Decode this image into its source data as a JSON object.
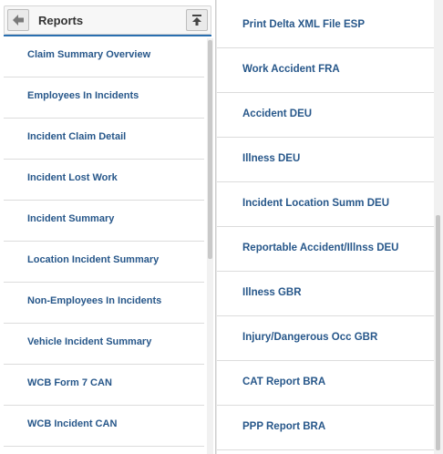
{
  "header": {
    "title": "Reports",
    "back_icon": "arrow-left-icon",
    "top_icon": "scroll-to-top-icon"
  },
  "left_list": [
    {
      "label": "Claim Summary Overview"
    },
    {
      "label": "Employees In Incidents"
    },
    {
      "label": "Incident Claim Detail"
    },
    {
      "label": "Incident Lost Work"
    },
    {
      "label": "Incident Summary"
    },
    {
      "label": "Location Incident Summary"
    },
    {
      "label": "Non-Employees In Incidents"
    },
    {
      "label": "Vehicle Incident Summary"
    },
    {
      "label": "WCB Form 7 CAN"
    },
    {
      "label": "WCB Incident CAN"
    }
  ],
  "right_list": [
    {
      "label": "Print Delta XML File ESP"
    },
    {
      "label": "Work Accident FRA"
    },
    {
      "label": "Accident DEU"
    },
    {
      "label": "Illness DEU"
    },
    {
      "label": "Incident Location Summ DEU"
    },
    {
      "label": "Reportable Accident/Illnss DEU"
    },
    {
      "label": "Illness GBR"
    },
    {
      "label": "Injury/Dangerous Occ GBR"
    },
    {
      "label": "CAT Report BRA"
    },
    {
      "label": "PPP Report BRA"
    }
  ],
  "colors": {
    "link": "#27578a",
    "accent": "#2a6fb0"
  }
}
